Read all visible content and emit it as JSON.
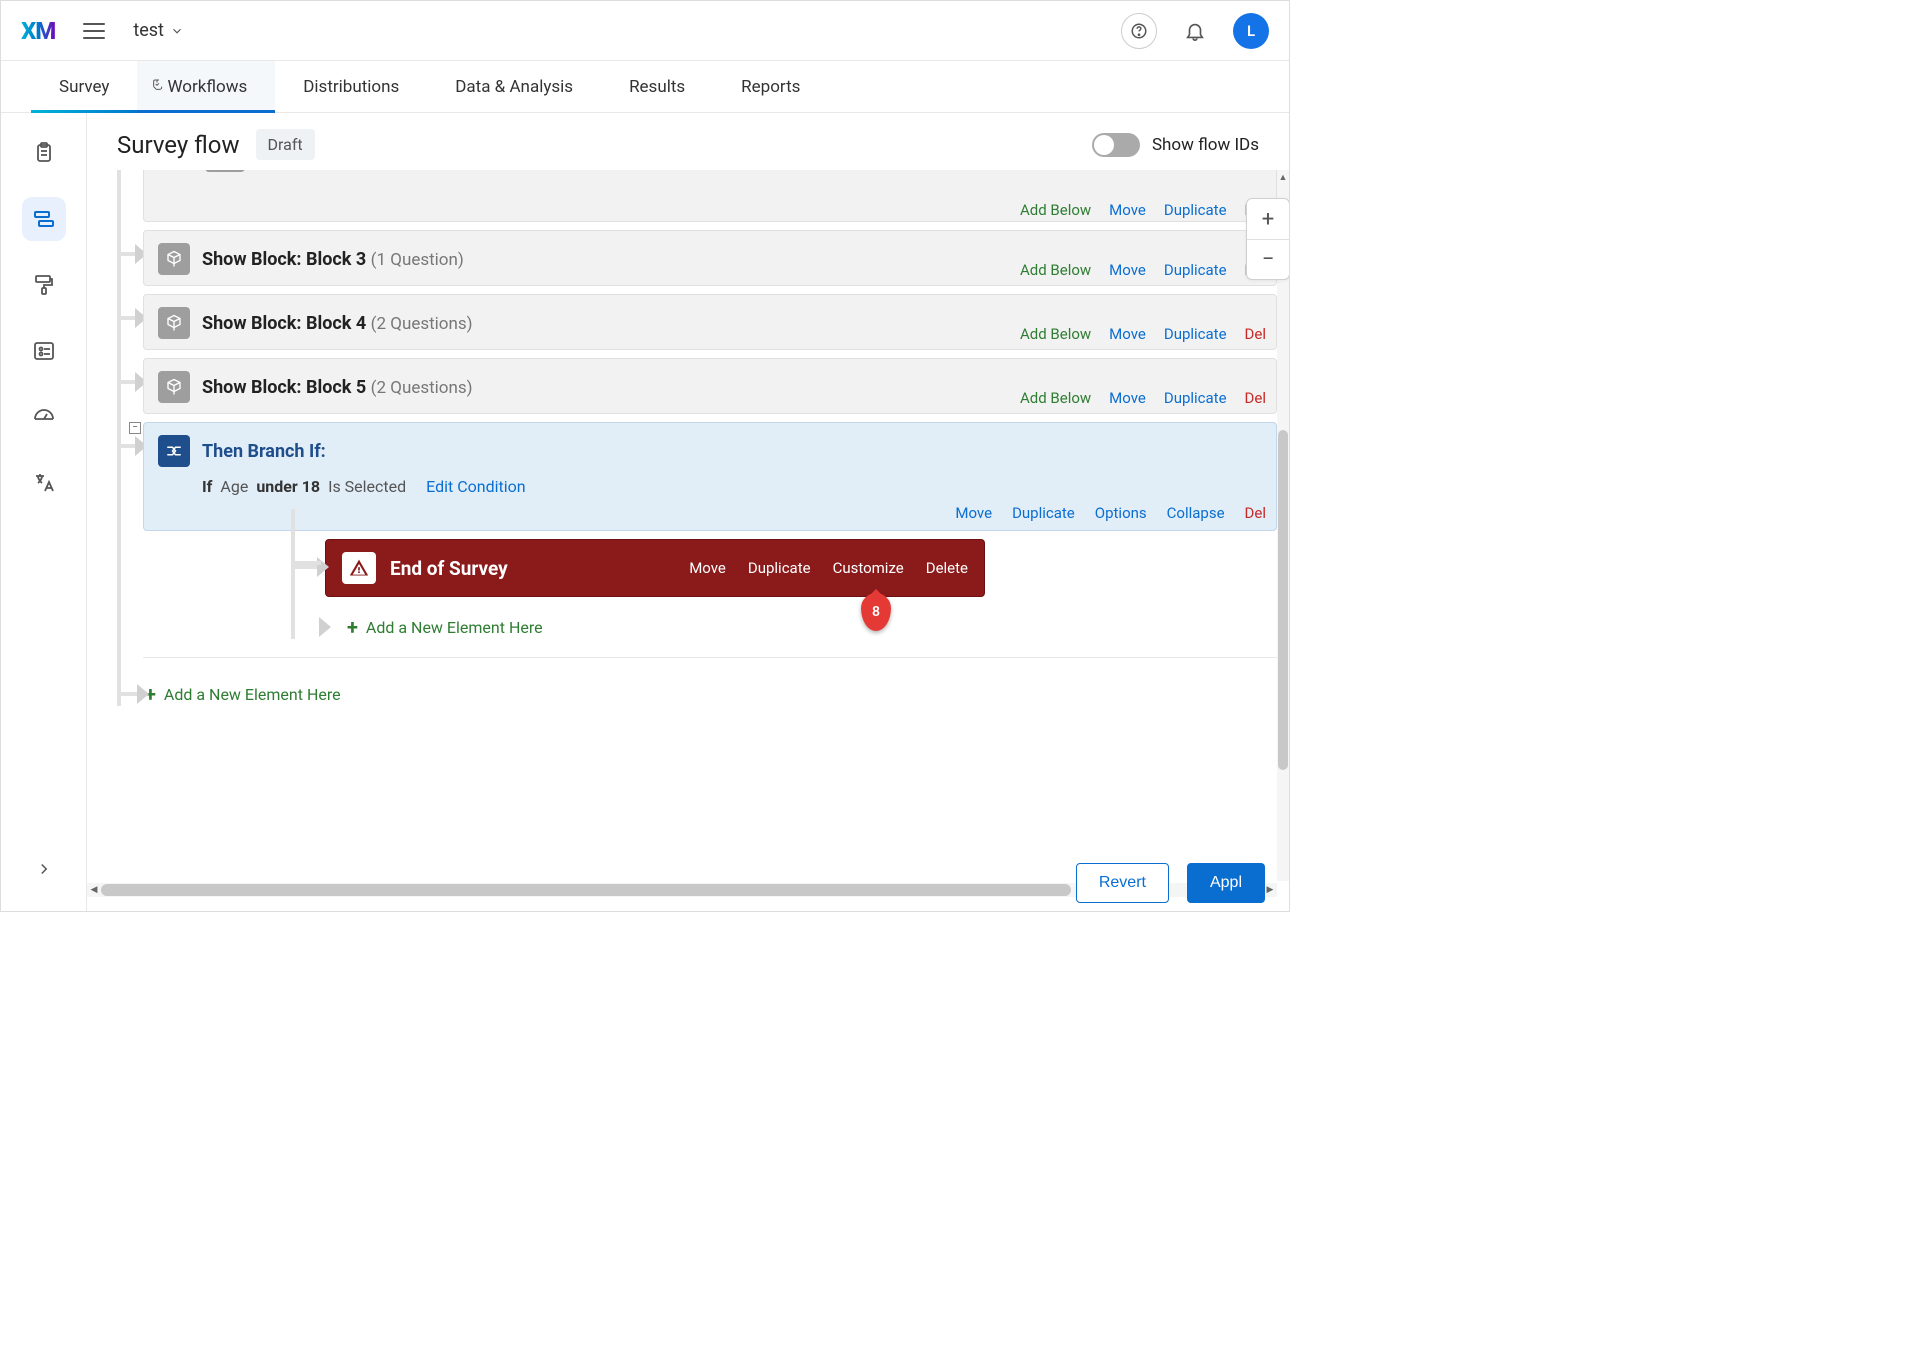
{
  "header": {
    "logo": "XM",
    "projectName": "test",
    "avatarInitial": "L"
  },
  "tabs": [
    "Survey",
    "Workflows",
    "Distributions",
    "Data & Analysis",
    "Results",
    "Reports"
  ],
  "page": {
    "title": "Survey flow",
    "badge": "Draft",
    "toggleLabel": "Show flow IDs"
  },
  "actions": {
    "addBelow": "Add Below",
    "move": "Move",
    "duplicate": "Duplicate",
    "delete": "Delete",
    "del": "Del",
    "options": "Options",
    "collapse": "Collapse",
    "customize": "Customize",
    "editCondition": "Edit Condition",
    "addNewElement": "Add a New Element Here",
    "revert": "Revert",
    "apply": "Appl"
  },
  "blocks": [
    {
      "prefix": "Show Block: ",
      "name": "Block 3",
      "sub": "(1 Question)"
    },
    {
      "prefix": "Show Block: ",
      "name": "Block 4",
      "sub": "(2 Questions)"
    },
    {
      "prefix": "Show Block: ",
      "name": "Block 5",
      "sub": "(2 Questions)"
    }
  ],
  "branch": {
    "title": "Then Branch If:",
    "ifLabel": "If",
    "question": "Age",
    "value": "under 18",
    "operator": "Is Selected"
  },
  "eos": {
    "title": "End of Survey"
  },
  "pin": "8"
}
